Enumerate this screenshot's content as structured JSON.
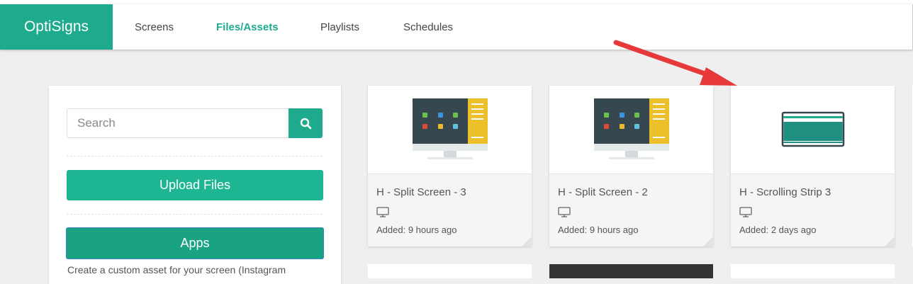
{
  "app": {
    "brand": "OptiSigns"
  },
  "nav": {
    "items": [
      {
        "label": "Screens",
        "active": false
      },
      {
        "label": "Files/Assets",
        "active": true
      },
      {
        "label": "Playlists",
        "active": false
      },
      {
        "label": "Schedules",
        "active": false
      }
    ]
  },
  "sidebar": {
    "search_placeholder": "Search",
    "upload_label": "Upload Files",
    "apps_label": "Apps",
    "apps_description": "Create a custom asset for your screen (Instagram"
  },
  "assets": [
    {
      "title": "H - Split Screen - 3",
      "added": "Added: 9 hours ago",
      "thumbnail_icon": "split-screen-monitor-icon"
    },
    {
      "title": "H - Split Screen - 2",
      "added": "Added: 9 hours ago",
      "thumbnail_icon": "split-screen-monitor-icon"
    },
    {
      "title": "H - Scrolling Strip 3",
      "added": "Added: 2 days ago",
      "thumbnail_icon": "scrolling-strip-icon"
    }
  ],
  "colors": {
    "accent": "#1eab8d",
    "annotation_arrow": "#e8393a",
    "monitor_screen": "#37474f",
    "monitor_side_panel": "#ecc02a"
  }
}
